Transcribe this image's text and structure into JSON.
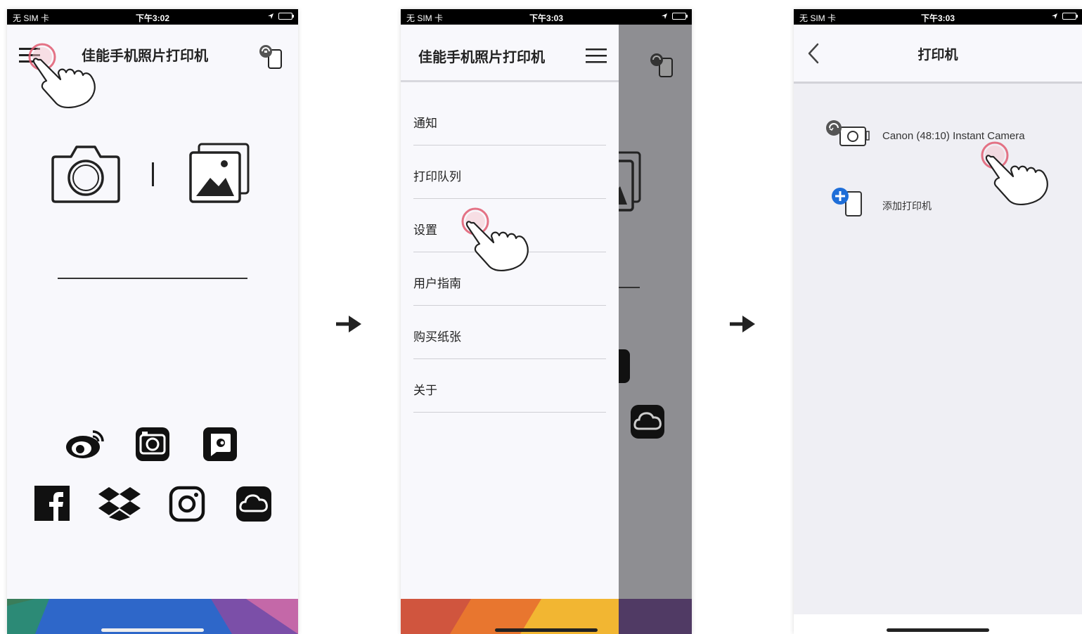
{
  "status_bar": {
    "carrier": "无 SIM 卡",
    "time_1": "下午3:02",
    "time_2": "下午3:03",
    "time_3": "下午3:03"
  },
  "screen1": {
    "title": "佳能手机照片打印机",
    "icons": [
      "menu-icon",
      "printer-status-icon",
      "camera-icon",
      "gallery-icon",
      "weibo-icon",
      "photo-app-icon",
      "chat-app-icon",
      "facebook-icon",
      "dropbox-icon",
      "instagram-icon",
      "cloud-icon"
    ]
  },
  "screen2": {
    "title": "佳能手机照片打印机",
    "menu_items": [
      "通知",
      "打印队列",
      "设置",
      "用户指南",
      "购买纸张",
      "关于"
    ]
  },
  "screen3": {
    "title": "打印机",
    "printer_name": "Canon (48:10) Instant Camera",
    "add_printer": "添加打印机"
  },
  "colors": {
    "tap_ring": "#e05a70",
    "accent_blue": "#1e6ed8"
  }
}
